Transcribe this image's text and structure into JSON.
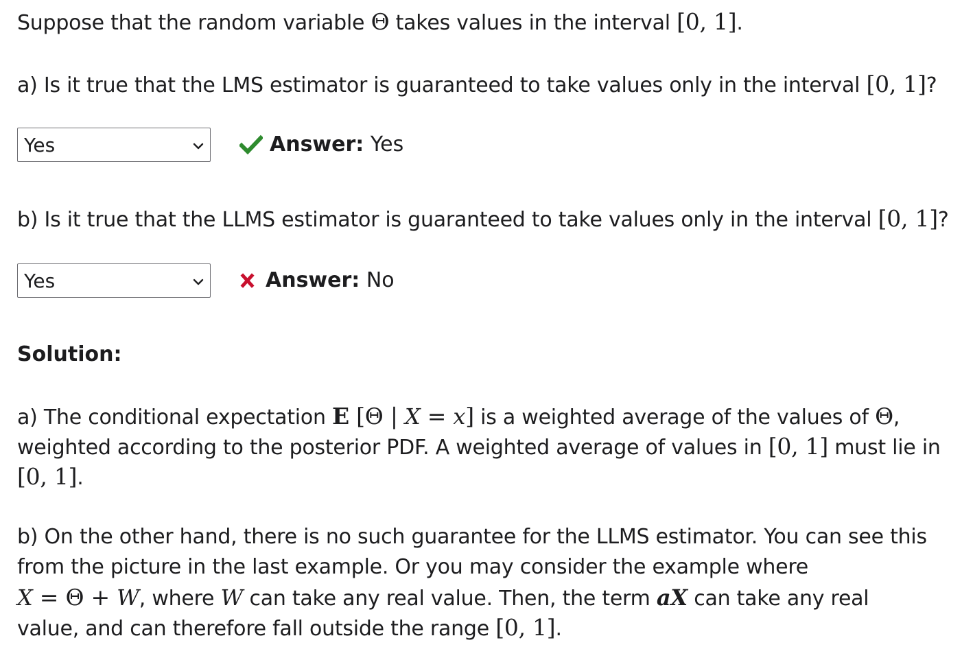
{
  "intro": {
    "t1": "Suppose that the random variable ",
    "theta": "Θ",
    "t2": " takes values in the interval ",
    "interval": "[0, 1]",
    "end": "."
  },
  "question_a": {
    "t1": "a) Is it true that the LMS estimator is guaranteed to take values only in the interval ",
    "interval": "[0, 1]",
    "end": "?",
    "selected": "Yes",
    "answer_label": "Answer:",
    "answer_value": "Yes",
    "status": "correct",
    "status_color": "#2e8b2e"
  },
  "question_b": {
    "t1": "b) Is it true that the LLMS estimator is guaranteed to take values only in the interval ",
    "interval": "[0, 1]",
    "end": "?",
    "selected": "Yes",
    "answer_label": "Answer:",
    "answer_value": "No",
    "status": "incorrect",
    "status_color": "#c8102e"
  },
  "solution": {
    "title": "Solution:",
    "a_l1": {
      "t1": "a) The conditional expectation ",
      "E": "E",
      "bracket_open": "[",
      "theta": "Θ",
      "bar": "|",
      "X": "X",
      "eq": "=",
      "x": "x",
      "bracket_close": "]",
      "t2": " is a weighted average of the values of ",
      "theta2": "Θ",
      "end": ","
    },
    "a_l2": {
      "t1": "weighted according to the posterior PDF. A weighted average of values in ",
      "interval": "[0, 1]",
      "t2": " must lie in"
    },
    "a_l3": {
      "interval": "[0, 1]",
      "end": "."
    },
    "b_l1": "b) On the other hand, there is no such guarantee for the LLMS estimator. You can see this",
    "b_l2": "from the picture in the last example. Or you may consider the example where",
    "b_l3": {
      "X": "X",
      "eq": "=",
      "theta": "Θ",
      "plus": "+",
      "W": "W",
      "t1": ", where ",
      "W2": "W",
      "t2": " can take any real value. Then, the term ",
      "aX": "aX",
      "t3": " can take any real"
    },
    "b_l4": {
      "t1": "value, and can therefore fall outside the range ",
      "interval": "[0, 1]",
      "end": "."
    }
  },
  "icons": {
    "correct": "checkmark-icon",
    "incorrect": "x-mark-icon",
    "dropdown": "chevron-down-icon"
  }
}
